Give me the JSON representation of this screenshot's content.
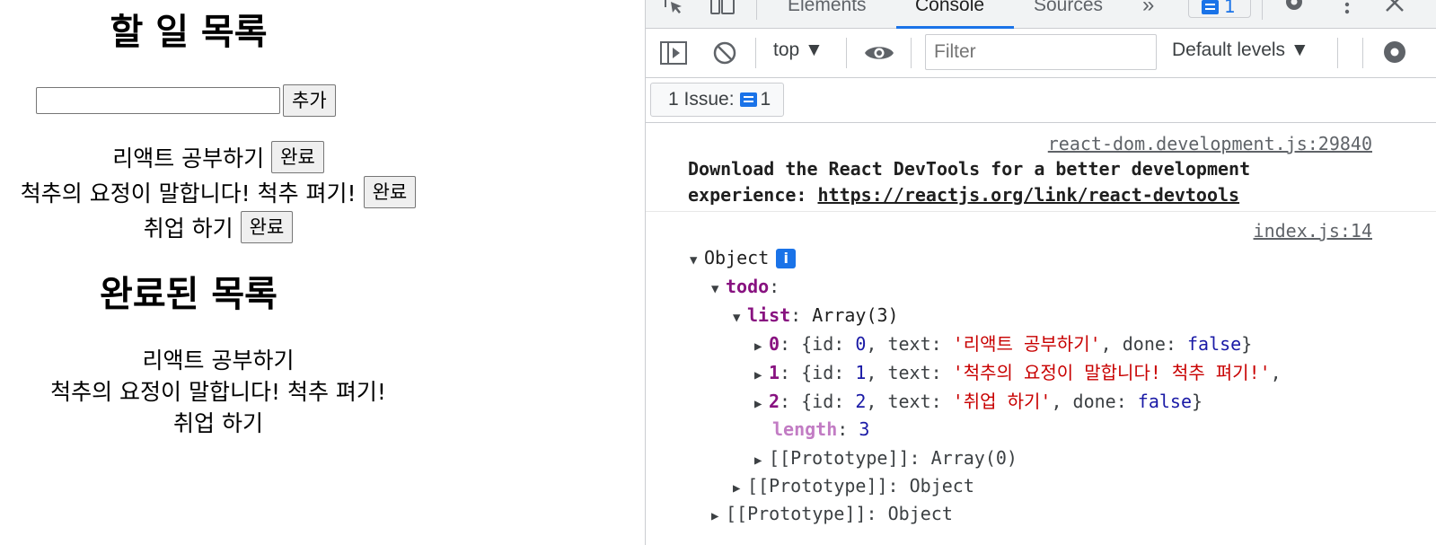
{
  "app": {
    "todo_title": "할 일 목록",
    "input_value": "",
    "add_button": "추가",
    "todos": [
      {
        "text": "리액트 공부하기",
        "button": "완료"
      },
      {
        "text": "척추의 요정이 말합니다! 척추 펴기!",
        "button": "완료"
      },
      {
        "text": "취업 하기",
        "button": "완료"
      }
    ],
    "done_title": "완료된 목록",
    "done": [
      "리액트 공부하기",
      "척추의 요정이 말합니다! 척추 펴기!",
      "취업 하기"
    ]
  },
  "devtools": {
    "tabs": {
      "elements": "Elements",
      "console": "Console",
      "sources": "Sources",
      "more": "»"
    },
    "message_count": "1",
    "toolbar": {
      "context": "top ▼",
      "filter_placeholder": "Filter",
      "levels": "Default levels ▼"
    },
    "issues": {
      "label": "1 Issue:",
      "count": "1"
    },
    "messages": [
      {
        "source": "react-dom.development.js:29840",
        "text": "Download the React DevTools for a better development experience:",
        "link": "https://reactjs.org/link/react-devtools"
      },
      {
        "source": "index.js:14",
        "object_label": "Object",
        "info": "i",
        "todo_key": "todo",
        "list_key": "list",
        "list_type": "Array(3)",
        "items": [
          {
            "index": "0",
            "id": "0",
            "text": "'리액트 공부하기'",
            "done": "false",
            "tail": "}"
          },
          {
            "index": "1",
            "id": "1",
            "text": "'척추의 요정이 말합니다! 척추 펴기!'",
            "done": "",
            "tail": ","
          },
          {
            "index": "2",
            "id": "2",
            "text": "'취업 하기'",
            "done": "false",
            "tail": "}"
          }
        ],
        "length_key": "length",
        "length_value": "3",
        "proto_array": "[[Prototype]]: Array(0)",
        "proto_object_inner": "[[Prototype]]: Object",
        "proto_object_outer": "[[Prototype]]: Object"
      }
    ],
    "colors": {
      "accent": "#1a73e8",
      "string": "#c80000",
      "key": "#881280",
      "number": "#1a1aa6"
    }
  }
}
